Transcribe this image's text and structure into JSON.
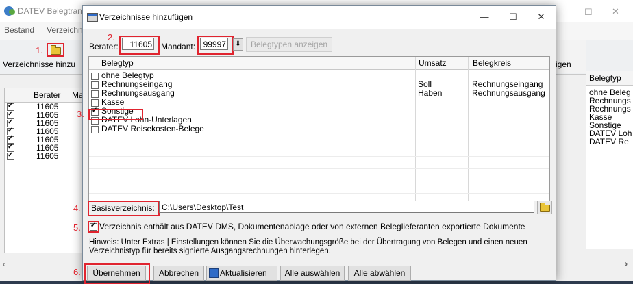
{
  "background_window": {
    "title": "DATEV Belegtrans",
    "menu": [
      "Bestand",
      "Verzeichnis"
    ],
    "toolbar_label": "Verzeichnisse hinzu",
    "right_toolbar_label": "igen",
    "left_grid": {
      "headers": [
        "Berater",
        "Ma"
      ],
      "rows": [
        "11605",
        "11605",
        "11605",
        "11605",
        "11605",
        "11605",
        "11605"
      ]
    },
    "right_grid": {
      "header": "Belegtyp",
      "rows": [
        "ohne Beleg",
        "Rechnungs",
        "Rechnungs",
        "Kasse",
        "Sonstige",
        "DATEV Loh",
        "DATEV Re"
      ]
    }
  },
  "dialog": {
    "title": "Verzeichnisse hinzufügen",
    "window_buttons": {
      "minimize": "—",
      "maximize": "☐",
      "close": "✕"
    },
    "berater_label": "Berater:",
    "berater_value": "11605",
    "mandant_label": "Mandant:",
    "mandant_value": "99997",
    "belegtypen_button": "Belegtypen anzeigen",
    "columns": [
      "Belegtyp",
      "Umsatz",
      "Belegkreis"
    ],
    "rows": [
      {
        "label": "ohne Belegtyp",
        "umsatz": "",
        "belegkreis": "",
        "checked": false
      },
      {
        "label": "Rechnungseingang",
        "umsatz": "Soll",
        "belegkreis": "Rechnungseingang",
        "checked": false
      },
      {
        "label": "Rechnungsausgang",
        "umsatz": "Haben",
        "belegkreis": "Rechnungsausgang",
        "checked": false
      },
      {
        "label": "Kasse",
        "umsatz": "",
        "belegkreis": "",
        "checked": false
      },
      {
        "label": "Sonstige",
        "umsatz": "",
        "belegkreis": "",
        "checked": true
      },
      {
        "label": "DATEV Lohn-Unterlagen",
        "umsatz": "",
        "belegkreis": "",
        "checked": false
      },
      {
        "label": "DATEV Reisekosten-Belege",
        "umsatz": "",
        "belegkreis": "",
        "checked": false
      }
    ],
    "basis_label": "Basisverzeichnis:",
    "basis_value": "C:\\Users\\Desktop\\Test",
    "dms_checkbox_label": "Verzeichnis enthält aus DATEV DMS, Dokumentenablage oder von externen Beleglieferanten exportierte Dokumente",
    "dms_checked": true,
    "hint": "Hinweis: Unter Extras | Einstellungen können Sie die Überwachungsgröße bei der Übertragung von Belegen und einen neuen Verzeichnistyp für bereits signierte Ausgangsrechnungen hinterlegen.",
    "buttons": {
      "apply": "Übernehmen",
      "cancel": "Abbrechen",
      "refresh": "Aktualisieren",
      "select_all": "Alle auswählen",
      "deselect_all": "Alle abwählen"
    }
  },
  "annotations": [
    "1.",
    "2.",
    "3.",
    "4.",
    "5.",
    "6."
  ],
  "colors": {
    "annotation": "#e0242f",
    "folder": "#e9c437",
    "accent": "#2f6bc7"
  }
}
